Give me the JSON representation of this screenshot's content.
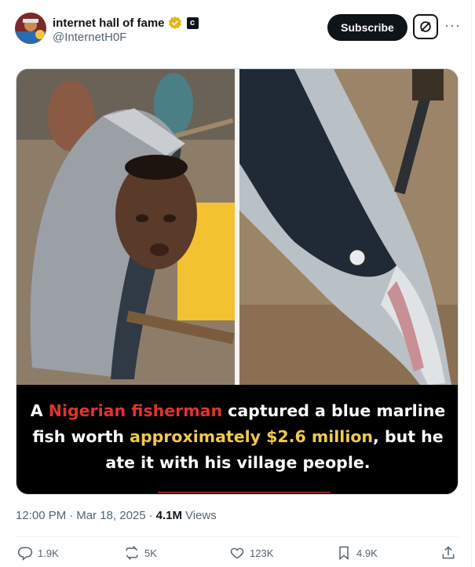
{
  "header": {
    "display_name": "internet hall of fame",
    "handle": "@InternetH0F",
    "affiliate_badge_letter": "c",
    "subscribe_label": "Subscribe",
    "more_label": "···"
  },
  "media": {
    "caption_parts": {
      "p1": "A ",
      "p2": "Nigerian fisherman",
      "p3": " captured a blue marline",
      "p4": "fish worth ",
      "p5": "approximately $2.6 million",
      "p6": ", but he",
      "p7": "ate it with his village people."
    },
    "colors": {
      "highlight_red": "#e0332f",
      "highlight_gold": "#f2c94c"
    }
  },
  "meta": {
    "time": "12:00 PM",
    "dot1": "·",
    "date": "Mar 18, 2025",
    "dot2": "·",
    "views_count": "4.1M",
    "views_label": "Views"
  },
  "actions": {
    "replies": "1.9K",
    "reposts": "5K",
    "likes": "123K",
    "bookmarks": "4.9K"
  },
  "icons": [
    "verified-gold-icon",
    "affiliate-badge-icon",
    "grok-icon",
    "more-icon",
    "reply-icon",
    "repost-icon",
    "like-icon",
    "bookmark-icon",
    "share-icon"
  ]
}
